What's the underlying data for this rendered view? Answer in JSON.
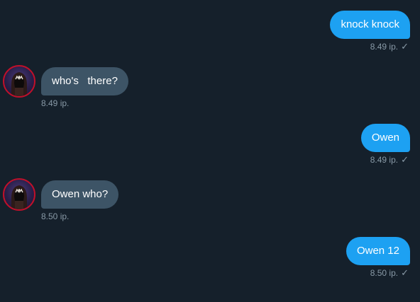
{
  "messages": [
    {
      "direction": "out",
      "text": "knock knock",
      "time": "8.49 ip.",
      "status_icon": "check-icon"
    },
    {
      "direction": "in",
      "text": "who's   there?",
      "time": "8.49 ip.",
      "avatar_icon": "hooded-figure-avatar"
    },
    {
      "direction": "out",
      "text": "Owen",
      "time": "8.49 ip.",
      "status_icon": "check-icon"
    },
    {
      "direction": "in",
      "text": "Owen who?",
      "time": "8.50 ip.",
      "avatar_icon": "hooded-figure-avatar"
    },
    {
      "direction": "out",
      "text": "Owen 12",
      "time": "8.50 ip.",
      "status_icon": "check-icon"
    }
  ],
  "colors": {
    "background": "#15202b",
    "outgoing_bubble": "#1da1f2",
    "incoming_bubble": "#3d5466",
    "meta_text": "#8899a6"
  }
}
